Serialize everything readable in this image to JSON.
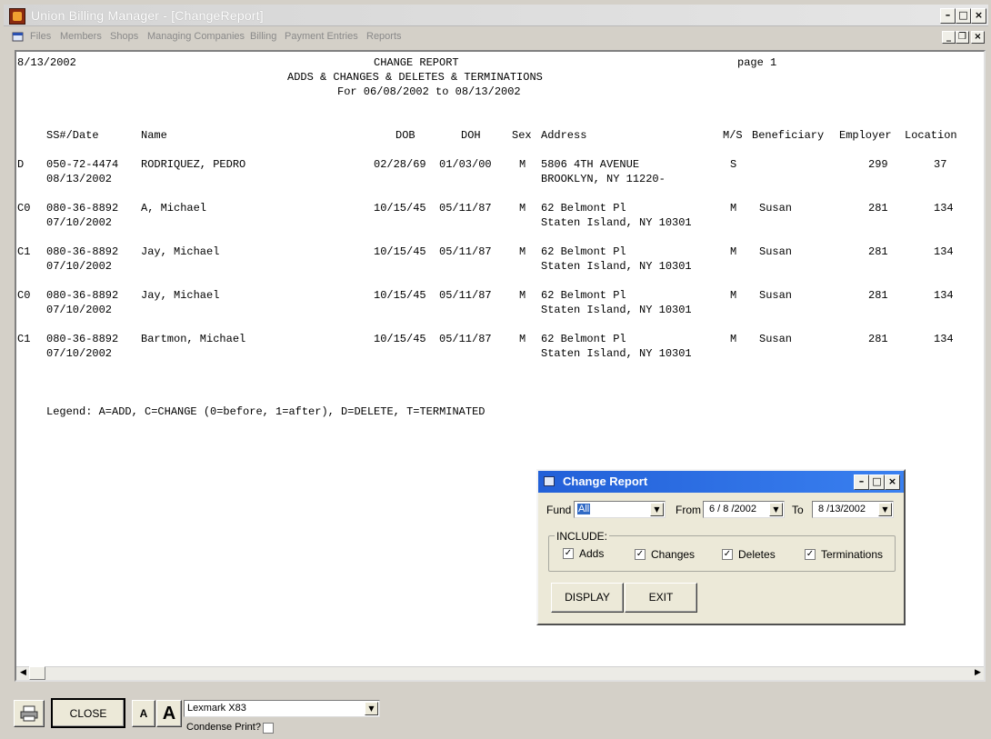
{
  "window": {
    "title": "Union Billing Manager - [ChangeReport]"
  },
  "menu": [
    "Files",
    "Members",
    "Shops",
    "Managing Companies",
    "Billing",
    "Payment Entries",
    "Reports"
  ],
  "report": {
    "date": "8/13/2002",
    "title": "CHANGE REPORT",
    "page": "page 1",
    "subtitle": "ADDS & CHANGES & DELETES & TERMINATIONS",
    "range": "For 06/08/2002 to 08/13/2002",
    "columns": {
      "ss": "SS#/Date",
      "name": "Name",
      "dob": "DOB",
      "doh": "DOH",
      "sex": "Sex",
      "address": "Address",
      "ms": "M/S",
      "beneficiary": "Beneficiary",
      "employer": "Employer",
      "location": "Location"
    },
    "rows": [
      {
        "code": "D",
        "ss": "050-72-4474",
        "date": "08/13/2002",
        "name": "RODRIQUEZ, PEDRO",
        "dob": "02/28/69",
        "doh": "01/03/00",
        "sex": "M",
        "addr1": "5806 4TH AVENUE",
        "addr2": "BROOKLYN, NY 11220-",
        "ms": "S",
        "beneficiary": "",
        "employer": "299",
        "location": "37"
      },
      {
        "code": "C0",
        "ss": "080-36-8892",
        "date": "07/10/2002",
        "name": "A, Michael",
        "dob": "10/15/45",
        "doh": "05/11/87",
        "sex": "M",
        "addr1": "62 Belmont Pl",
        "addr2": "Staten Island, NY 10301",
        "ms": "M",
        "beneficiary": "Susan",
        "employer": "281",
        "location": "134"
      },
      {
        "code": "C1",
        "ss": "080-36-8892",
        "date": "07/10/2002",
        "name": "Jay, Michael",
        "dob": "10/15/45",
        "doh": "05/11/87",
        "sex": "M",
        "addr1": "62 Belmont Pl",
        "addr2": "Staten Island, NY 10301",
        "ms": "M",
        "beneficiary": "Susan",
        "employer": "281",
        "location": "134"
      },
      {
        "code": "C0",
        "ss": "080-36-8892",
        "date": "07/10/2002",
        "name": "Jay, Michael",
        "dob": "10/15/45",
        "doh": "05/11/87",
        "sex": "M",
        "addr1": "62 Belmont Pl",
        "addr2": "Staten Island, NY 10301",
        "ms": "M",
        "beneficiary": "Susan",
        "employer": "281",
        "location": "134"
      },
      {
        "code": "C1",
        "ss": "080-36-8892",
        "date": "07/10/2002",
        "name": "Bartmon, Michael",
        "dob": "10/15/45",
        "doh": "05/11/87",
        "sex": "M",
        "addr1": "62 Belmont Pl",
        "addr2": "Staten Island, NY 10301",
        "ms": "M",
        "beneficiary": "Susan",
        "employer": "281",
        "location": "134"
      }
    ],
    "legend": "Legend: A=ADD, C=CHANGE (0=before, 1=after), D=DELETE, T=TERMINATED"
  },
  "dialog": {
    "title": "Change Report",
    "fund_label": "Fund",
    "fund_value": "All",
    "from_label": "From",
    "from_value": "6 / 8 /2002",
    "to_label": "To",
    "to_value": "8 /13/2002",
    "include_label": "INCLUDE:",
    "checks": [
      {
        "label": "Adds",
        "checked": true
      },
      {
        "label": "Changes",
        "checked": true
      },
      {
        "label": "Deletes",
        "checked": true
      },
      {
        "label": "Terminations",
        "checked": true
      }
    ],
    "display_label": "DISPLAY",
    "exit_label": "EXIT"
  },
  "toolbar": {
    "close_label": "CLOSE",
    "font_small": "A",
    "font_large": "A",
    "printer": "Lexmark X83",
    "condense_label": "Condense Print?",
    "condense_checked": false
  },
  "icons": {
    "check_glyph": "✓",
    "print": "printer-icon",
    "dropdown": "▼"
  }
}
